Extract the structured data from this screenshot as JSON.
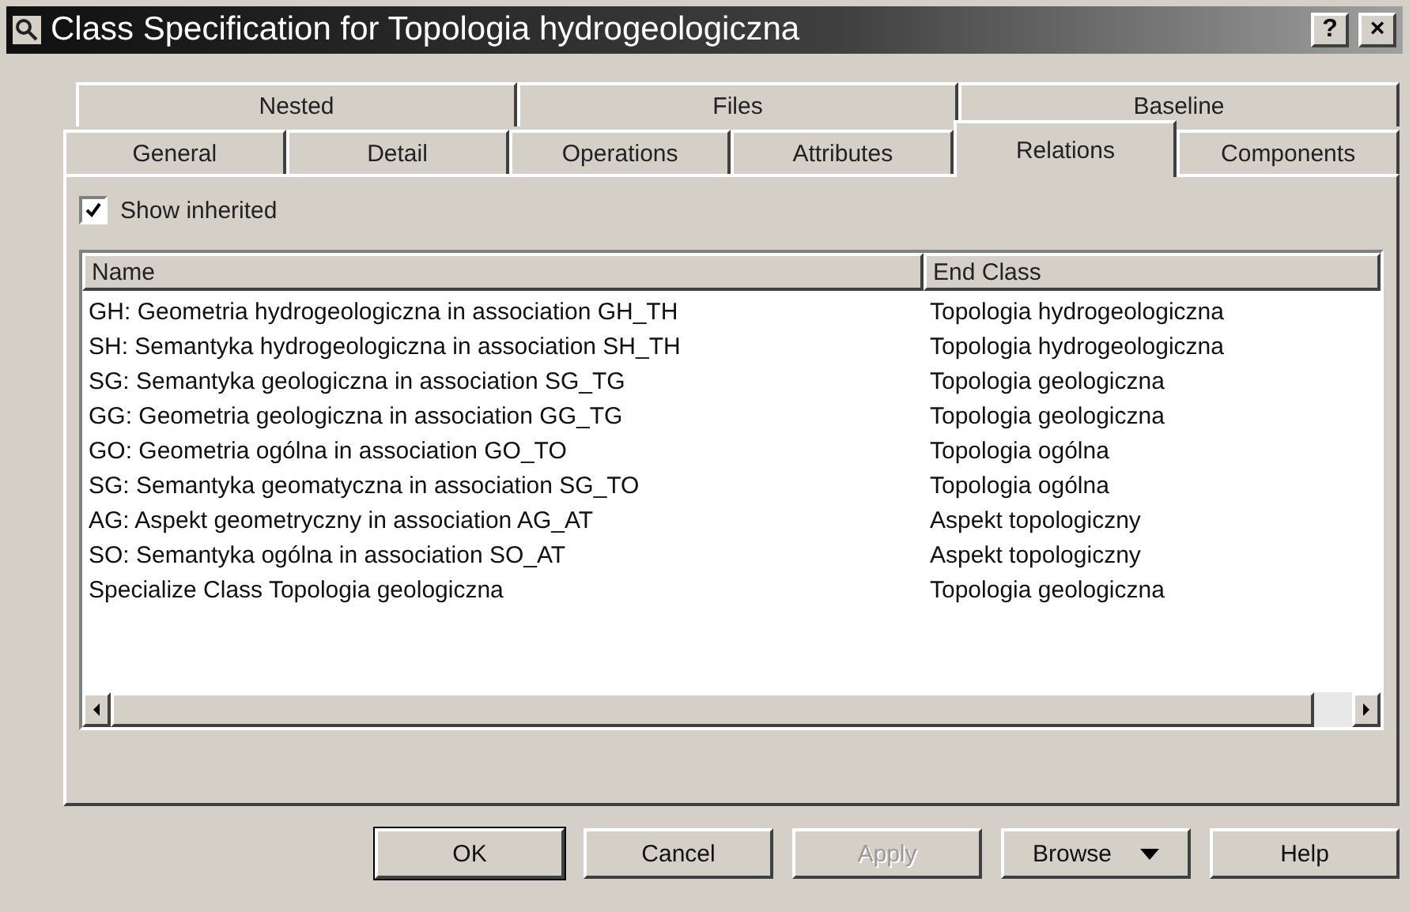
{
  "window": {
    "title": "Class Specification for Topologia hydrogeologiczna",
    "help_button": "?",
    "close_button": "×"
  },
  "tab_rows": [
    {
      "tabs": [
        {
          "label": "Nested",
          "selected": false
        },
        {
          "label": "Files",
          "selected": false
        },
        {
          "label": "Baseline",
          "selected": false
        }
      ]
    },
    {
      "tabs": [
        {
          "label": "General",
          "selected": false
        },
        {
          "label": "Detail",
          "selected": false
        },
        {
          "label": "Operations",
          "selected": false
        },
        {
          "label": "Attributes",
          "selected": false
        },
        {
          "label": "Relations",
          "selected": true
        },
        {
          "label": "Components",
          "selected": false
        }
      ]
    }
  ],
  "show_inherited": {
    "label": "Show inherited",
    "checked": true
  },
  "table": {
    "columns": [
      "Name",
      "End Class"
    ],
    "rows": [
      [
        "GH: Geometria hydrogeologiczna in association GH_TH",
        "Topologia hydrogeologiczna"
      ],
      [
        "SH: Semantyka hydrogeologiczna in association SH_TH",
        "Topologia hydrogeologiczna"
      ],
      [
        "SG: Semantyka geologiczna in association SG_TG",
        "Topologia geologiczna"
      ],
      [
        "GG: Geometria geologiczna in association GG_TG",
        "Topologia geologiczna"
      ],
      [
        "GO: Geometria ogólna in association GO_TO",
        "Topologia ogólna"
      ],
      [
        "SG: Semantyka geomatyczna in association SG_TO",
        "Topologia ogólna"
      ],
      [
        "AG: Aspekt geometryczny in association AG_AT",
        "Aspekt topologiczny"
      ],
      [
        "SO: Semantyka ogólna in association SO_AT",
        "Aspekt topologiczny"
      ],
      [
        "Specialize Class Topologia geologiczna",
        "Topologia geologiczna"
      ]
    ]
  },
  "buttons": [
    {
      "label": "OK",
      "kind": "default",
      "disabled": false
    },
    {
      "label": "Cancel",
      "kind": "plain",
      "disabled": false
    },
    {
      "label": "Apply",
      "kind": "plain",
      "disabled": true
    },
    {
      "label": "Browse",
      "kind": "menu",
      "disabled": false
    },
    {
      "label": "Help",
      "kind": "plain",
      "disabled": false
    }
  ]
}
